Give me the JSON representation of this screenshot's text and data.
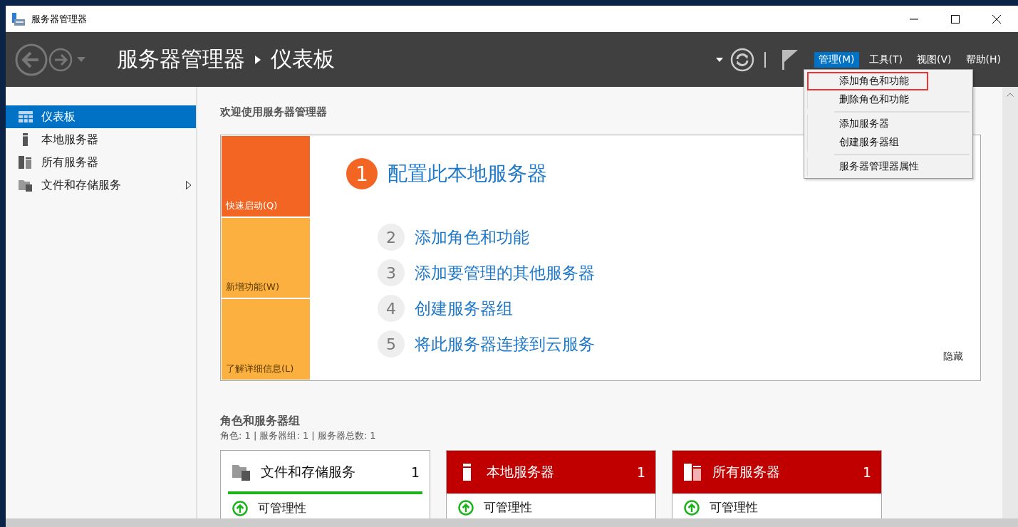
{
  "window": {
    "title": "服务器管理器"
  },
  "header": {
    "breadcrumb": [
      "服务器管理器",
      "仪表板"
    ],
    "menus": [
      {
        "label": "管理(M)",
        "selected": true
      },
      {
        "label": "工具(T)",
        "selected": false
      },
      {
        "label": "视图(V)",
        "selected": false
      },
      {
        "label": "帮助(H)",
        "selected": false
      }
    ]
  },
  "dropdown": {
    "groups": [
      [
        {
          "label": "添加角色和功能",
          "highlighted": true
        },
        {
          "label": "删除角色和功能",
          "highlighted": false
        }
      ],
      [
        {
          "label": "添加服务器",
          "highlighted": false
        },
        {
          "label": "创建服务器组",
          "highlighted": false
        }
      ],
      [
        {
          "label": "服务器管理器属性",
          "highlighted": false
        }
      ]
    ]
  },
  "sidebar": {
    "items": [
      {
        "label": "仪表板",
        "kind": "dashboard",
        "selected": true,
        "expandable": false
      },
      {
        "label": "本地服务器",
        "kind": "server",
        "selected": false,
        "expandable": false
      },
      {
        "label": "所有服务器",
        "kind": "servers",
        "selected": false,
        "expandable": false
      },
      {
        "label": "文件和存储服务",
        "kind": "folder",
        "selected": false,
        "expandable": true
      }
    ]
  },
  "welcome": {
    "title": "欢迎使用服务器管理器",
    "tiles": [
      {
        "label": "快速启动(Q)",
        "selected": true
      },
      {
        "label": "新增功能(W)",
        "selected": false
      },
      {
        "label": "了解详细信息(L)",
        "selected": false
      }
    ],
    "steps": [
      {
        "number": "1",
        "label": "配置此本地服务器",
        "primary": true
      },
      {
        "number": "2",
        "label": "添加角色和功能",
        "primary": false
      },
      {
        "number": "3",
        "label": "添加要管理的其他服务器",
        "primary": false
      },
      {
        "number": "4",
        "label": "创建服务器组",
        "primary": false
      },
      {
        "number": "5",
        "label": "将此服务器连接到云服务",
        "primary": false
      }
    ],
    "hide": "隐藏"
  },
  "roles": {
    "title": "角色和服务器组",
    "summary": "角色: 1 | 服务器组: 1 | 服务器总数: 1",
    "cards": [
      {
        "name": "文件和存储服务",
        "count": "1",
        "kind": "folder",
        "alert": false,
        "rows": [
          "可管理性"
        ]
      },
      {
        "name": "本地服务器",
        "count": "1",
        "kind": "server",
        "alert": true,
        "rows": [
          "可管理性"
        ]
      },
      {
        "name": "所有服务器",
        "count": "1",
        "kind": "servers",
        "alert": true,
        "rows": [
          "可管理性"
        ]
      }
    ]
  }
}
